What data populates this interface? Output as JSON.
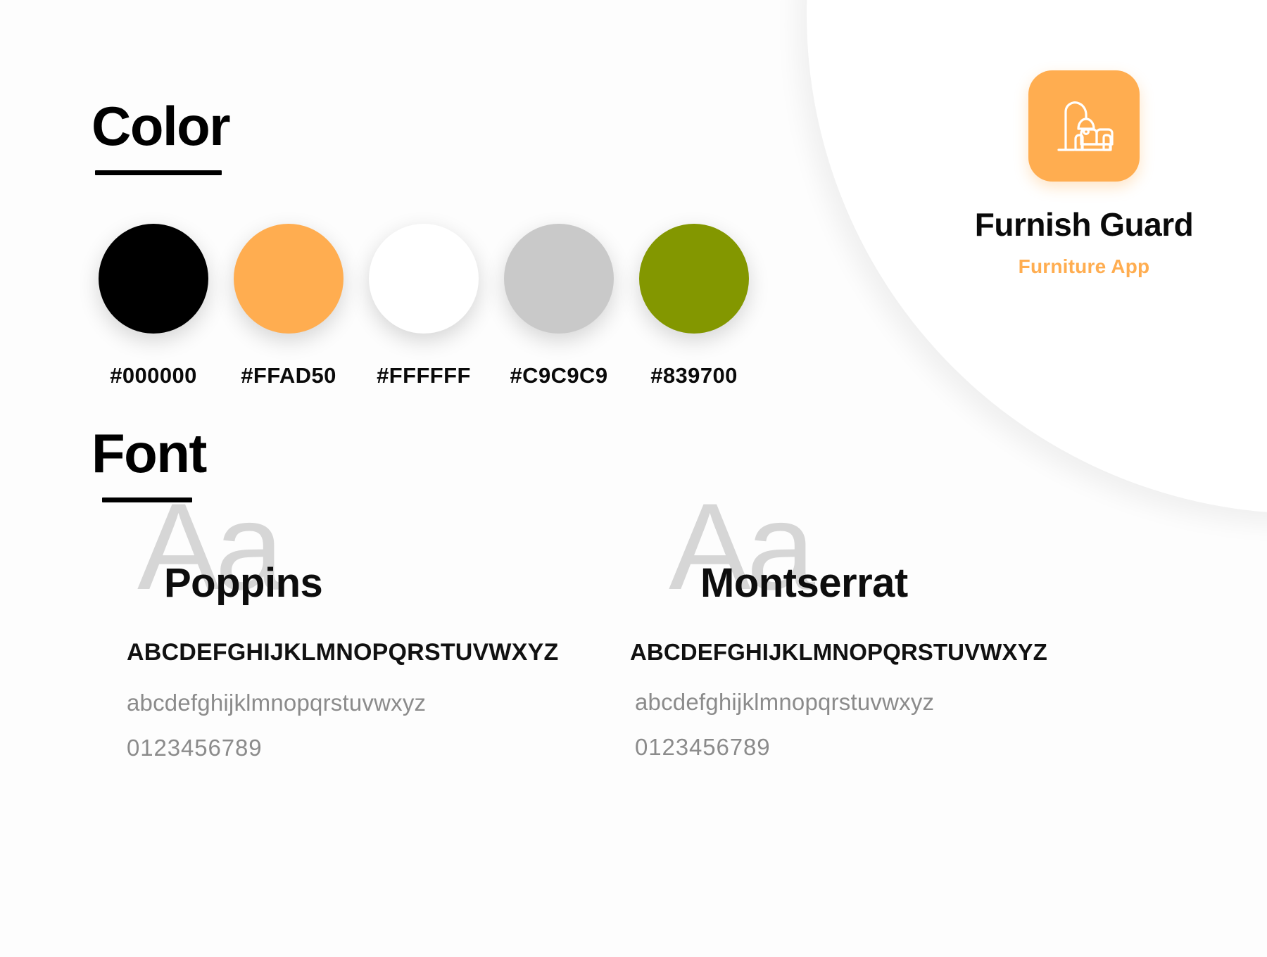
{
  "brand": {
    "logo_icon": "sofa-lamp-icon",
    "logo_background": "#FFAD50",
    "name": "Furnish Guard",
    "tagline": "Furniture App",
    "tagline_color": "#FFAD50"
  },
  "sections": {
    "color": {
      "title": "Color"
    },
    "font": {
      "title": "Font"
    }
  },
  "palette": [
    {
      "hex": "#000000",
      "label": "#000000"
    },
    {
      "hex": "#FFAD50",
      "label": "#FFAD50"
    },
    {
      "hex": "#FFFFFF",
      "label": "#FFFFFF"
    },
    {
      "hex": "#C9C9C9",
      "label": "#C9C9C9"
    },
    {
      "hex": "#839700",
      "label": "#839700"
    }
  ],
  "fonts": [
    {
      "watermark": "Aa",
      "name": "Poppins",
      "uppercase": "ABCDEFGHIJKLMNOPQRSTUVWXYZ",
      "lowercase": "abcdefghijklmnopqrstuvwxyz",
      "digits": "0123456789"
    },
    {
      "watermark": "Aa",
      "name": "Montserrat",
      "uppercase": "ABCDEFGHIJKLMNOPQRSTUVWXYZ",
      "lowercase": "abcdefghijklmnopqrstuvwxyz",
      "digits": "0123456789"
    }
  ]
}
